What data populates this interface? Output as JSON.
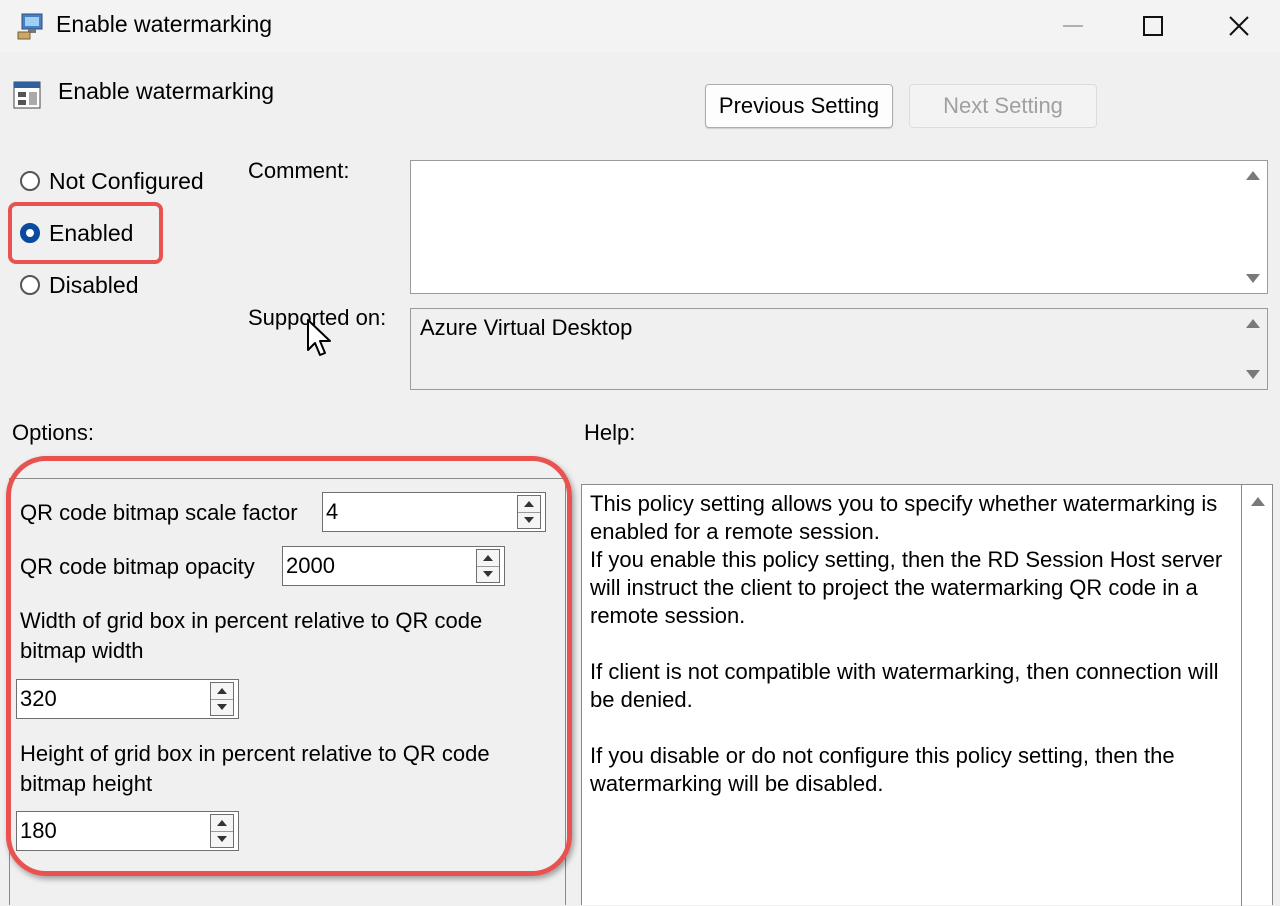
{
  "window": {
    "title": "Enable watermarking",
    "minimize_icon": "minimize-icon",
    "maximize_icon": "maximize-icon",
    "close_icon": "close-icon"
  },
  "header": {
    "policy_title": "Enable watermarking",
    "previous_label": "Previous Setting",
    "next_label": "Next Setting"
  },
  "state": {
    "options": [
      "Not Configured",
      "Enabled",
      "Disabled"
    ],
    "selected": "Enabled"
  },
  "comment": {
    "label": "Comment:",
    "value": ""
  },
  "supported": {
    "label": "Supported on:",
    "value": "Azure Virtual Desktop"
  },
  "options_panel": {
    "label": "Options:",
    "scale_label": "QR code bitmap scale factor",
    "scale_value": "4",
    "opacity_label": "QR code bitmap opacity",
    "opacity_value": "2000",
    "width_label": "Width of grid box in percent relative to QR code bitmap width",
    "width_value": "320",
    "height_label": "Height of grid box in percent relative to QR code bitmap height",
    "height_value": "180"
  },
  "help_panel": {
    "label": "Help:",
    "p1": "This policy setting allows you to specify whether watermarking is enabled for a remote session.\nIf you enable this policy setting, then the RD Session Host server will instruct the client to project the watermarking QR code in a remote session.",
    "p2": "If client is not compatible with watermarking, then connection will be denied.",
    "p3": "If you disable or do not configure this policy setting, then the watermarking will be disabled."
  },
  "colors": {
    "highlight": "#e8534f",
    "radio_accent": "#0a4a9f"
  }
}
